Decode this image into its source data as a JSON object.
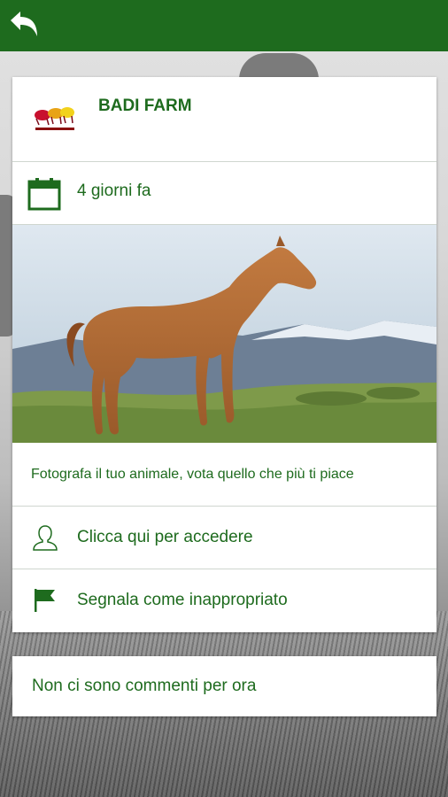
{
  "header": {
    "back_icon": "back-arrow-icon",
    "color": "#1e6b1e"
  },
  "post": {
    "author": "BADI FARM",
    "logo_icon": "badi-farm-logo",
    "date_icon": "calendar-icon",
    "time_ago": "4 giorni fa",
    "photo": "horse-photo",
    "caption": "Fotografa il tuo animale, vota quello che più ti piace"
  },
  "actions": {
    "login_icon": "user-icon",
    "login_label": "Clicca qui per accedere",
    "report_icon": "flag-icon",
    "report_label": "Segnala come inappropriato"
  },
  "comments": {
    "empty_label": "Non ci sono commenti per ora"
  },
  "colors": {
    "accent": "#1e6b1e",
    "card": "#ffffff"
  }
}
